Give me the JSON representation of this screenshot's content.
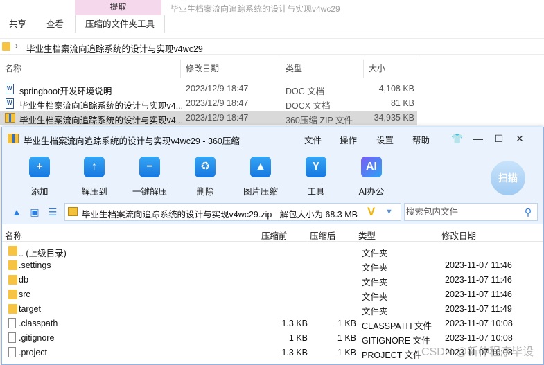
{
  "explorer": {
    "context_tab": "提取",
    "window_title": "毕业生档案流向追踪系统的设计与实现v4wc29",
    "ribbon_tabs": [
      "共享",
      "查看",
      "压缩的文件夹工具"
    ],
    "breadcrumb": "毕业生档案流向追踪系统的设计与实现v4wc29",
    "columns": {
      "name": "名称",
      "modified": "修改日期",
      "type": "类型",
      "size": "大小"
    },
    "files": [
      {
        "name": "springboot开发环境说明",
        "date": "2023/12/9 18:47",
        "type": "DOC 文档",
        "size": "4,108 KB",
        "icon": "word-doc-icon"
      },
      {
        "name": "毕业生档案流向追踪系统的设计与实现v4...",
        "date": "2023/12/9 18:47",
        "type": "DOCX 文档",
        "size": "81 KB",
        "icon": "word-doc-icon"
      },
      {
        "name": "毕业生档案流向追踪系统的设计与实现v4...",
        "date": "2023/12/9 18:47",
        "type": "360压缩 ZIP 文件",
        "size": "34,935 KB",
        "icon": "zip-archive-icon"
      }
    ]
  },
  "zip360": {
    "title": "毕业生档案流向追踪系统的设计与实现v4wc29 - 360压缩",
    "menu": [
      "文件",
      "操作",
      "设置",
      "帮助"
    ],
    "window_controls": {
      "skin": "👕",
      "minimize": "—",
      "maximize": "☐",
      "close": "✕"
    },
    "toolbar": [
      {
        "label": "添加",
        "icon": "add-icon",
        "glyph": "+"
      },
      {
        "label": "解压到",
        "icon": "extract-to-icon",
        "glyph": "↑"
      },
      {
        "label": "一键解压",
        "icon": "one-click-extract-icon",
        "glyph": "−"
      },
      {
        "label": "删除",
        "icon": "delete-icon",
        "glyph": "♻"
      },
      {
        "label": "图片压缩",
        "icon": "image-compress-icon",
        "glyph": "▲"
      },
      {
        "label": "工具",
        "icon": "tools-icon",
        "glyph": "Y"
      },
      {
        "label": "AI办公",
        "icon": "ai-office-icon",
        "glyph": "AI"
      }
    ],
    "scan_label": "扫描",
    "path_text": "毕业生档案流向追踪系统的设计与实现v4wc29.zip - 解包大小为 68.3 MB",
    "search_placeholder": "搜索包内文件",
    "columns": {
      "name": "名称",
      "compressed": "压缩前",
      "uncompressed": "压缩后",
      "type": "类型",
      "modified": "修改日期"
    },
    "rows": [
      {
        "name": ".. (上级目录)",
        "before": "",
        "after": "",
        "type": "文件夹",
        "date": "",
        "kind": "folder"
      },
      {
        "name": ".settings",
        "before": "",
        "after": "",
        "type": "文件夹",
        "date": "2023-11-07 11:46",
        "kind": "folder"
      },
      {
        "name": "db",
        "before": "",
        "after": "",
        "type": "文件夹",
        "date": "2023-11-07 11:46",
        "kind": "folder"
      },
      {
        "name": "src",
        "before": "",
        "after": "",
        "type": "文件夹",
        "date": "2023-11-07 11:46",
        "kind": "folder"
      },
      {
        "name": "target",
        "before": "",
        "after": "",
        "type": "文件夹",
        "date": "2023-11-07 11:49",
        "kind": "folder"
      },
      {
        "name": ".classpath",
        "before": "1.3 KB",
        "after": "1 KB",
        "type": "CLASSPATH 文件",
        "date": "2023-11-07 10:08",
        "kind": "file"
      },
      {
        "name": ".gitignore",
        "before": "1 KB",
        "after": "1 KB",
        "type": "GITIGNORE 文件",
        "date": "2023-11-07 10:08",
        "kind": "file"
      },
      {
        "name": ".project",
        "before": "1.3 KB",
        "after": "1 KB",
        "type": "PROJECT 文件",
        "date": "2023-11-07 10:08",
        "kind": "file"
      }
    ],
    "watermark": "CSDN @新仲程序毕设"
  }
}
